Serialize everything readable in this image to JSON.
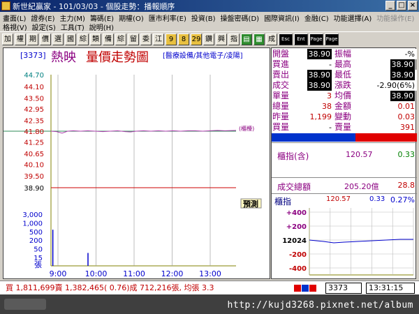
{
  "window": {
    "title": "新世紀贏家 - 101/03/03 - 個股走勢：播報順序",
    "buttons": [
      "_",
      "□",
      "×"
    ]
  },
  "menu": {
    "row1": [
      "畫面(L)",
      "證券(E)",
      "主力(M)",
      "籌碼(E)",
      "期權(O)",
      "匯市利率(E)",
      "投資(B)",
      "操盤密碼(D)",
      "國際資訊(I)",
      "金融(C)",
      "功能選擇(A)"
    ],
    "row1_disabled": "功能操作(E)",
    "row2": [
      "格視(V)",
      "設定(S)",
      "工具(T)",
      "說明(H)"
    ]
  },
  "toolbar": [
    "加",
    "權",
    "期",
    "價",
    "選",
    "國",
    "綜",
    "類",
    "備",
    "綜",
    "留",
    "委",
    "江",
    "9",
    "8",
    "29",
    "鑽",
    "興",
    "指",
    "▤",
    "▦",
    "成",
    "Esc",
    "Ent",
    "Page",
    "Page"
  ],
  "chart": {
    "stock_code": "[3373]",
    "stock_name": "熱映",
    "chart_title": "量價走勢圖",
    "industry": "[醫療設備/其他電子/凌陽]",
    "series_tag": "(櫃檯)",
    "ref_marker": "預測",
    "volume_unit": "張"
  },
  "chart_data": {
    "type": "line",
    "price_ticks": [
      "44.70",
      "44.10",
      "43.50",
      "42.95",
      "42.35",
      "41.80",
      "41.25",
      "40.65",
      "40.10",
      "39.50",
      "38.90"
    ],
    "reference_price": "41.80",
    "volume_ticks": [
      "3,000",
      "1,000",
      "500",
      "200",
      "50",
      "15"
    ],
    "time_ticks": [
      "9:00",
      "10:00",
      "11:00",
      "12:00",
      "13:00"
    ],
    "price_line": [
      [
        0,
        41.8
      ],
      [
        0.03,
        41.78
      ],
      [
        0.06,
        41.7
      ],
      [
        0.09,
        41.8
      ],
      [
        0.12,
        41.82
      ],
      [
        0.16,
        41.8
      ],
      [
        0.2,
        41.82
      ],
      [
        0.24,
        41.8
      ],
      [
        0.28,
        41.78
      ],
      [
        0.32,
        41.8
      ],
      [
        0.36,
        41.82
      ],
      [
        0.4,
        41.78
      ],
      [
        0.43,
        41.76
      ],
      [
        0.46,
        41.8
      ],
      [
        0.5,
        41.82
      ],
      [
        0.54,
        41.8
      ],
      [
        0.58,
        41.82
      ],
      [
        0.62,
        41.8
      ],
      [
        0.66,
        41.82
      ],
      [
        0.7,
        41.8
      ],
      [
        0.74,
        41.82
      ],
      [
        0.78,
        41.82
      ],
      [
        0.82,
        41.8
      ],
      [
        0.86,
        41.82
      ],
      [
        0.9,
        41.84
      ],
      [
        0.94,
        41.82
      ],
      [
        1.0,
        41.84
      ]
    ],
    "volume_bars": [
      [
        0.01,
        0.7
      ],
      [
        0.2,
        0.25
      ]
    ]
  },
  "quote": {
    "rows": [
      {
        "l1": "開盤",
        "v1": "38.90",
        "l2": "振幅",
        "v2": "-%",
        "v1blk": true,
        "v2blk": false
      },
      {
        "l1": "買進",
        "v1": "-",
        "l2": "最高",
        "v2": "38.90",
        "v1blk": false,
        "v2blk": true
      },
      {
        "l1": "賣出",
        "v1": "38.90",
        "l2": "最低",
        "v2": "38.90",
        "v1blk": true,
        "v2blk": true
      },
      {
        "l1": "成交",
        "v1": "38.90",
        "l2": "漲跌",
        "v2": "-2.90(6%)",
        "v1blk": true,
        "v2blk": false
      },
      {
        "l1": "單量",
        "v1": "3",
        "l2": "均價",
        "v2": "38.90",
        "v1blk": false,
        "v2blk": true
      },
      {
        "l1": "總量",
        "v1": "38",
        "l2": "金額",
        "v2": "0.01",
        "v1blk": false,
        "v2blk": false
      },
      {
        "l1": "昨量",
        "v1": "1,199",
        "l2": "變動",
        "v2": "0.03",
        "v1blk": false,
        "v2blk": false
      },
      {
        "l1": "買量",
        "v1": "-",
        "l2": "賣量",
        "v2": "391",
        "v1blk": false,
        "v2blk": false
      }
    ],
    "index_label": "櫃指(含)",
    "index_value": "120.57",
    "index_change": "0.33",
    "turnover_label": "成交總額",
    "turnover_value": "205.20億",
    "turnover_change": "28.8"
  },
  "mini_index": {
    "label": "櫃指",
    "value": "120.57",
    "change": "0.33",
    "pct": "0.27%",
    "ticks": [
      "+400",
      "+200",
      "12024",
      "-200",
      "-400"
    ]
  },
  "status": {
    "text": "買 1,811,699賣 1,382,465( 0.76)成 712,216張, 均張 3.3",
    "code": "3373",
    "clock": "13:31:15"
  },
  "watermark": "http://kujd3268.pixnet.net/album",
  "colors": {
    "titlebar": "#0a246a",
    "price_axis_red": "#c00000",
    "volume_blue": "#0000cc",
    "ref_line": "#2e8b57",
    "down_line": "#cc0000",
    "label_purple": "#8b0080"
  }
}
